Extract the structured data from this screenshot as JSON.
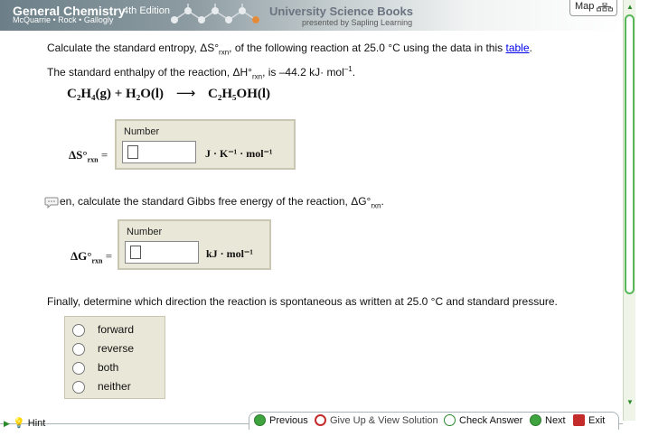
{
  "header": {
    "title": "General Chemistry",
    "edition": "4th Edition",
    "authors": "McQuarrie • Rock • Gallogly",
    "publisher": "University Science Books",
    "presented_by": "presented by Sapling Learning",
    "map_label": "Map"
  },
  "question1": {
    "line1_prefix": "Calculate the standard entropy, ΔS°",
    "line1_sub": "rxn",
    "line1_mid": ", of the following reaction at 25.0 °C using the data in this ",
    "link_text": "table",
    "line1_end": ".",
    "line2_prefix": "The standard enthalpy of the reaction, ΔH°",
    "line2_sub": "rxn",
    "line2_mid": ", is –44.2 kJ· mol",
    "line2_sup": "–1",
    "line2_end": "."
  },
  "equation": {
    "reactants": "C₂H₄(g) + H₂O(l)",
    "arrow": "⟶",
    "product": "C₂H₅OH(l)"
  },
  "entropy_box": {
    "label": "Number",
    "symbol": "ΔS°",
    "symbol_sub": "rxn",
    "equals": "=",
    "value": "",
    "unit": "J · K⁻¹ · mol⁻¹"
  },
  "question2": {
    "text_prefix": "en, calculate the standard Gibbs free energy of the reaction, ΔG°",
    "text_sub": "rxn",
    "text_end": "."
  },
  "gibbs_box": {
    "label": "Number",
    "symbol": "ΔG°",
    "symbol_sub": "rxn",
    "equals": "=",
    "value": "",
    "unit": "kJ · mol⁻¹"
  },
  "question3": {
    "text": "Finally, determine which direction the reaction is spontaneous as written at 25.0 °C and standard pressure."
  },
  "options": [
    "forward",
    "reverse",
    "both",
    "neither"
  ],
  "footer": {
    "hint": "Hint",
    "previous": "Previous",
    "give_up": "Give Up & View Solution",
    "check": "Check Answer",
    "next": "Next",
    "exit": "Exit"
  },
  "colors": {
    "accent_green": "#3fa33f",
    "give_up_red": "#c42b2b",
    "answer_box": "#e9e8d8",
    "link": "#0000ee"
  }
}
